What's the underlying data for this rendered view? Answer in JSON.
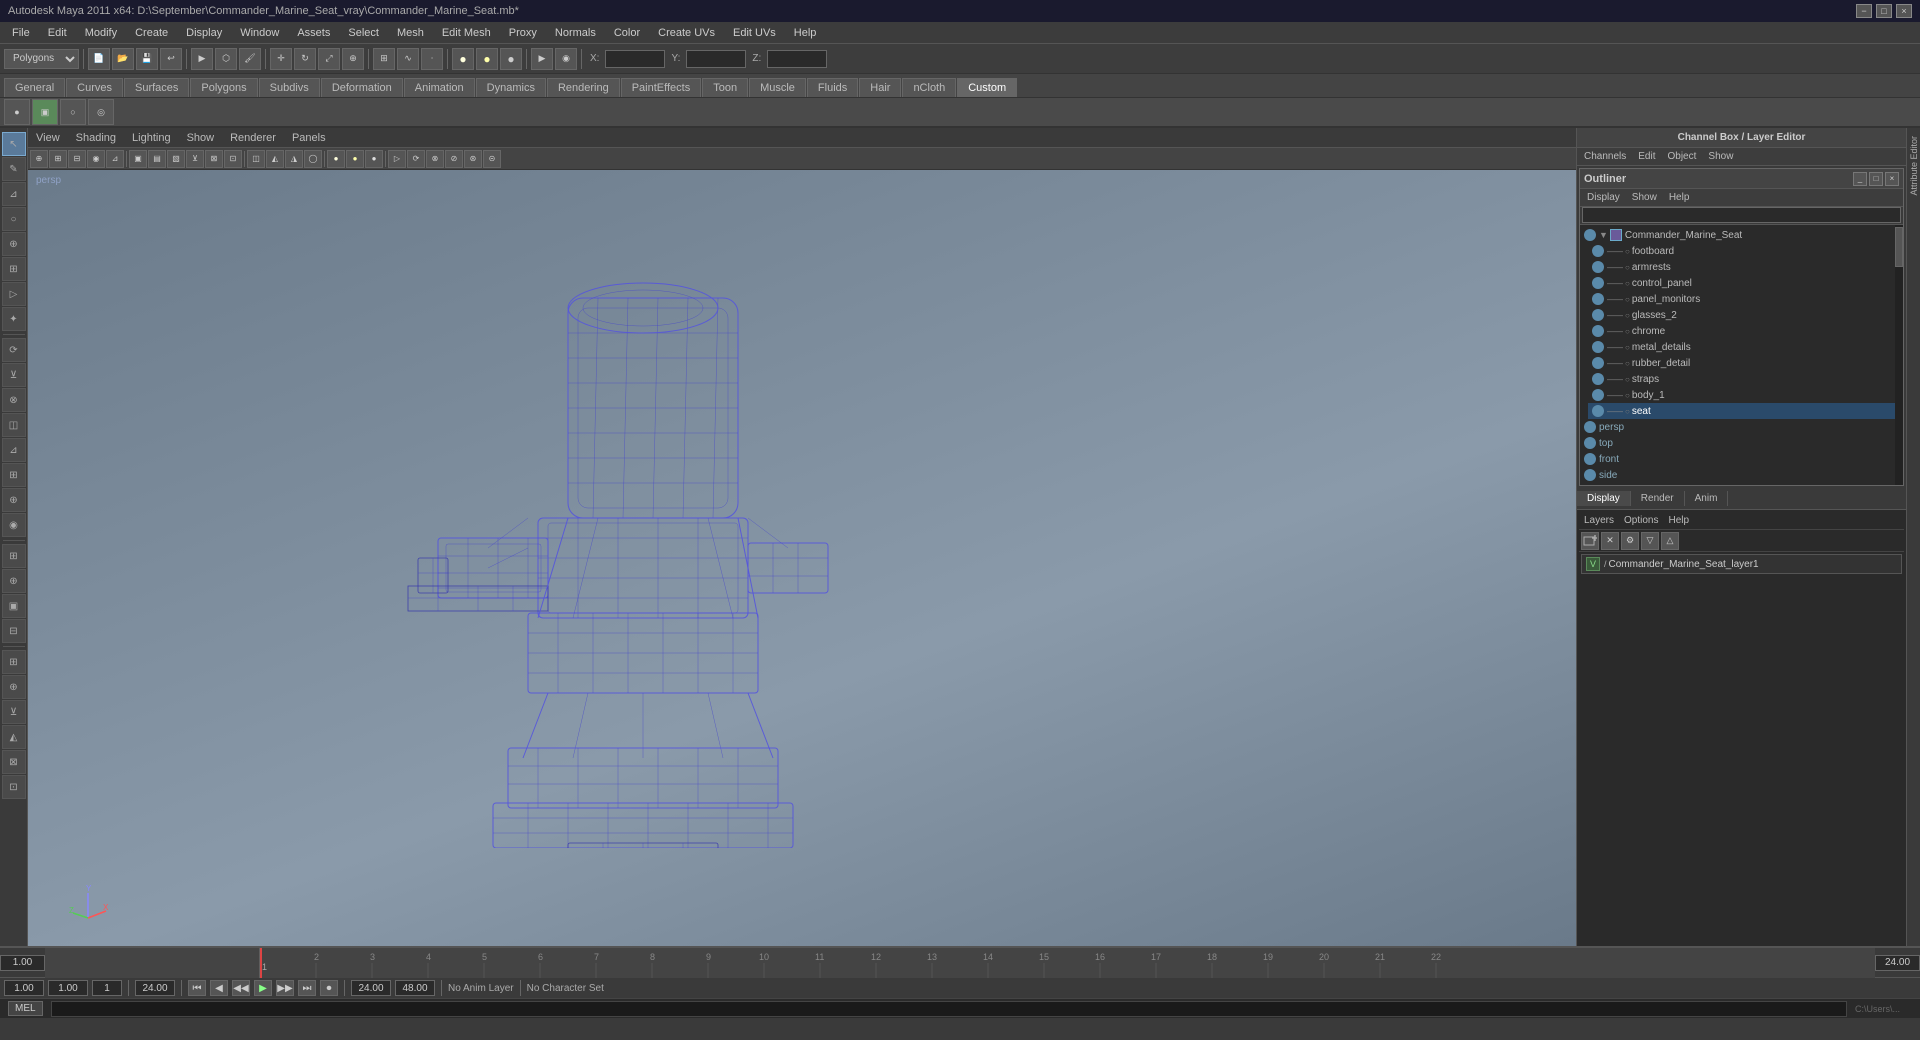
{
  "window": {
    "title": "Autodesk Maya 2011 x64: D:\\September\\Commander_Marine_Seat_vray\\Commander_Marine_Seat.mb*",
    "controls": [
      "−",
      "□",
      "×"
    ]
  },
  "menubar": {
    "items": [
      "File",
      "Edit",
      "Modify",
      "Create",
      "Display",
      "Window",
      "Assets",
      "Select",
      "Mesh",
      "Edit Mesh",
      "Proxy",
      "Normals",
      "Color",
      "Create UVs",
      "Edit UVs",
      "Help"
    ]
  },
  "toolbar": {
    "mode_dropdown": "Polygons",
    "coord_labels": [
      "X:",
      "Y:",
      "Z:"
    ]
  },
  "shelf_tabs": {
    "items": [
      "General",
      "Curves",
      "Surfaces",
      "Polygons",
      "Subdivs",
      "Deformation",
      "Animation",
      "Dynamics",
      "Rendering",
      "PaintEffects",
      "Toon",
      "Muscle",
      "Fluids",
      "Hair",
      "nCloth",
      "Custom"
    ],
    "active": "Custom"
  },
  "viewport": {
    "menu_items": [
      "View",
      "Shading",
      "Lighting",
      "Show",
      "Renderer",
      "Panels"
    ],
    "label": "persp"
  },
  "channel_box": {
    "title": "Channel Box / Layer Editor",
    "menu_items": [
      "Channels",
      "Edit",
      "Object",
      "Show"
    ]
  },
  "outliner": {
    "title": "Outliner",
    "menu_items": [
      "Display",
      "Show",
      "Help"
    ],
    "tree_items": [
      {
        "name": "Commander_Marine_Seat",
        "level": 0,
        "type": "group",
        "expanded": true
      },
      {
        "name": "footboard",
        "level": 1,
        "type": "mesh"
      },
      {
        "name": "armrests",
        "level": 1,
        "type": "mesh"
      },
      {
        "name": "control_panel",
        "level": 1,
        "type": "mesh"
      },
      {
        "name": "panel_monitors",
        "level": 1,
        "type": "mesh"
      },
      {
        "name": "glasses_2",
        "level": 1,
        "type": "mesh"
      },
      {
        "name": "chrome",
        "level": 1,
        "type": "mesh"
      },
      {
        "name": "metal_details",
        "level": 1,
        "type": "mesh"
      },
      {
        "name": "rubber_detail",
        "level": 1,
        "type": "mesh"
      },
      {
        "name": "straps",
        "level": 1,
        "type": "mesh"
      },
      {
        "name": "body_1",
        "level": 1,
        "type": "mesh"
      },
      {
        "name": "seat",
        "level": 1,
        "type": "mesh",
        "selected": true
      },
      {
        "name": "persp",
        "level": 0,
        "type": "camera"
      },
      {
        "name": "top",
        "level": 0,
        "type": "camera"
      },
      {
        "name": "front",
        "level": 0,
        "type": "camera"
      },
      {
        "name": "side",
        "level": 0,
        "type": "camera"
      }
    ]
  },
  "display_tabs": {
    "items": [
      "Display",
      "Render",
      "Anim"
    ],
    "active": "Display"
  },
  "layers": {
    "toolbar_buttons": [
      "new",
      "delete",
      "options"
    ],
    "items": [
      {
        "name": "Commander_Marine_Seat_layer1",
        "visible": true,
        "icon": "/"
      }
    ]
  },
  "timeline": {
    "start": "1.00",
    "end": "24.00",
    "current": "1.00",
    "range_end": "24.00",
    "anim_end": "48.00",
    "no_anim_layer": "No Anim Layer",
    "no_char_set": "No Character Set",
    "play_buttons": [
      "⏮",
      "◀",
      "▶▶",
      "▶",
      "⏭",
      "⏺"
    ],
    "current_frame": "1.00"
  },
  "statusbar": {
    "mode": "MEL",
    "path": "C:\\Users\\...",
    "no_char_set": "No Character Set"
  },
  "icons": {
    "eye": "👁",
    "mesh": "▣",
    "group": "▦",
    "camera": "📷",
    "arrow_right": "▶",
    "dash": "—"
  }
}
